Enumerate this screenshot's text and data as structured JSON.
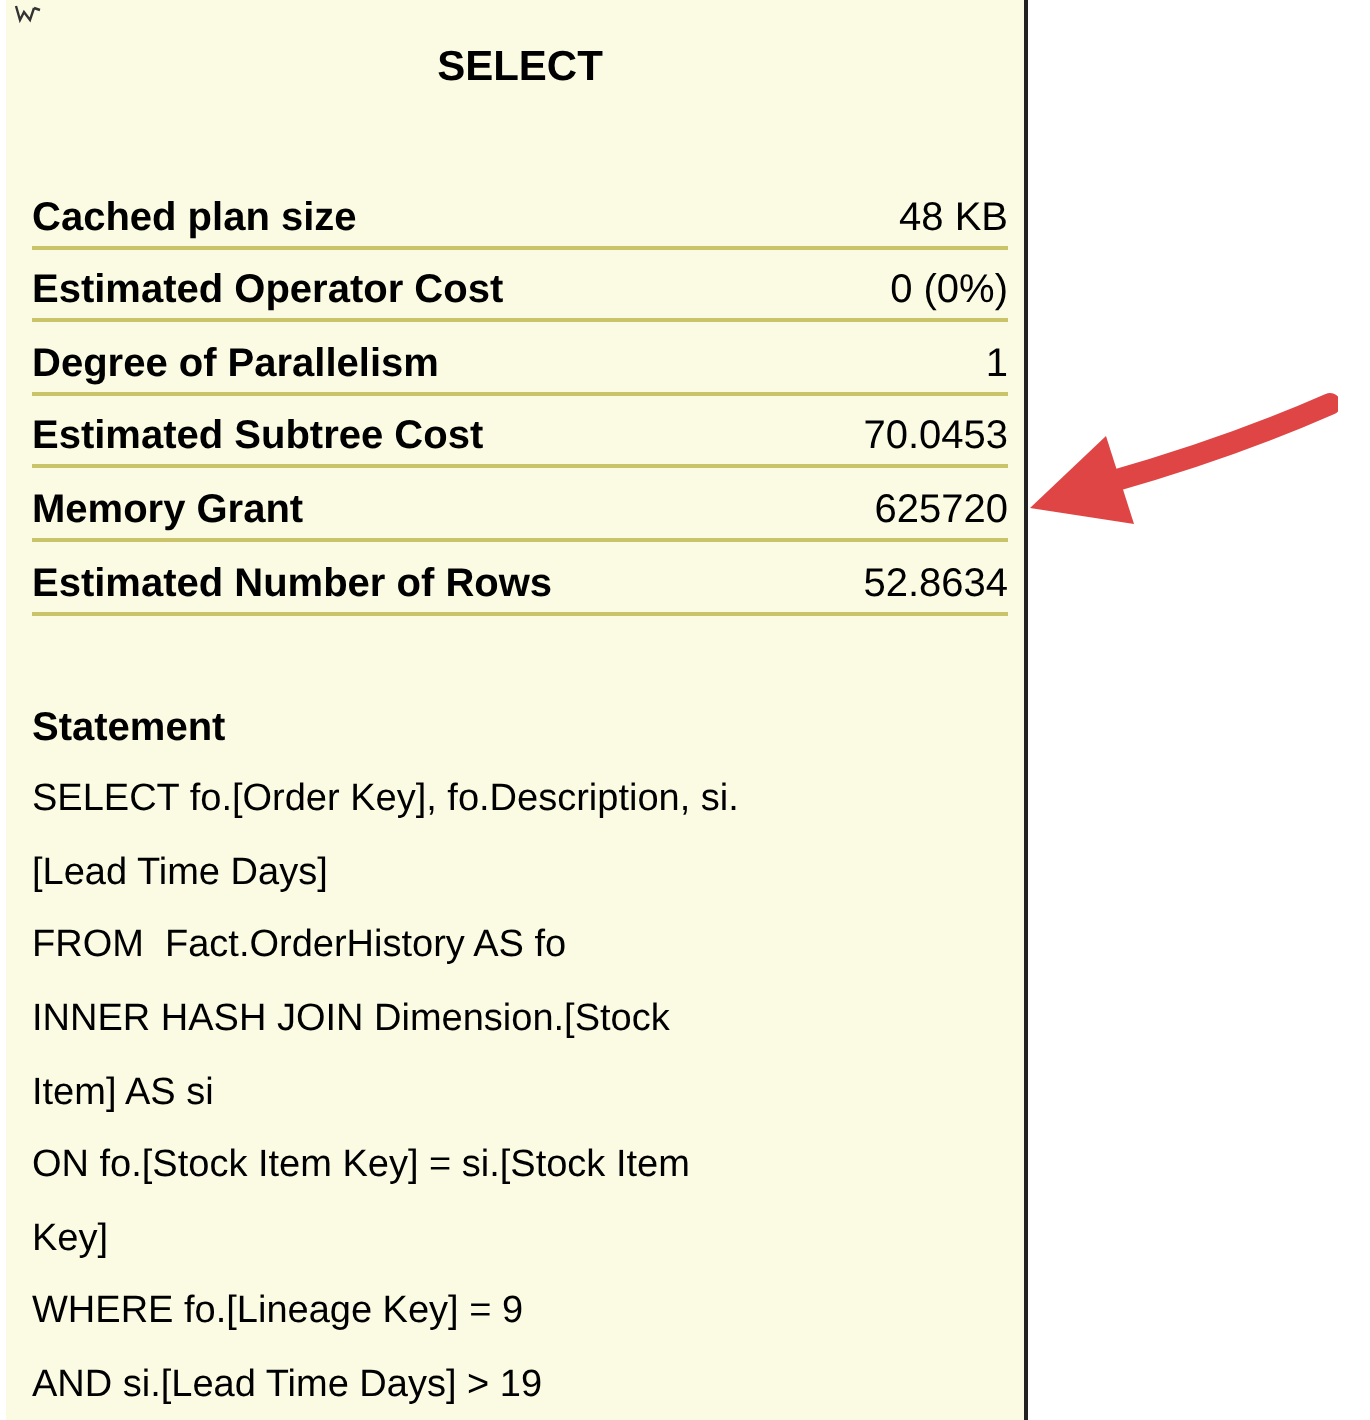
{
  "tooltip": {
    "title": "SELECT",
    "properties": [
      {
        "label": "Cached plan size",
        "value": "48 KB"
      },
      {
        "label": "Estimated Operator Cost",
        "value": "0 (0%)"
      },
      {
        "label": "Degree of Parallelism",
        "value": "1"
      },
      {
        "label": "Estimated Subtree Cost",
        "value": "70.0453"
      },
      {
        "label": "Memory Grant",
        "value": "625720"
      },
      {
        "label": "Estimated Number of Rows",
        "value": "52.8634"
      }
    ],
    "statement": {
      "label": "Statement",
      "lines": [
        "SELECT fo.[Order Key], fo.Description, si.",
        "[Lead Time Days]",
        "FROM  Fact.OrderHistory AS fo",
        "INNER HASH JOIN Dimension.[Stock",
        "Item] AS si",
        "ON fo.[Stock Item Key] = si.[Stock Item",
        "Key]",
        "WHERE fo.[Lineage Key] = 9",
        "AND si.[Lead Time Days] > 19"
      ]
    }
  }
}
